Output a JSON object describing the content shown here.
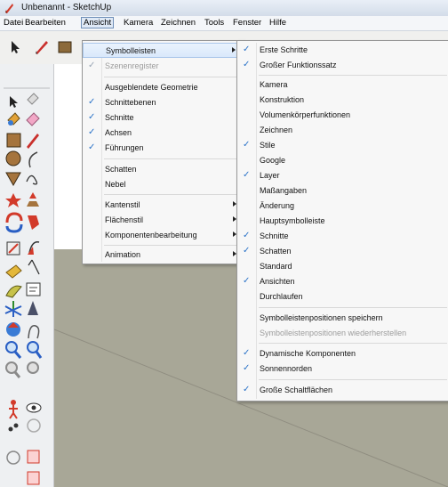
{
  "window": {
    "title": "Unbenannt - SketchUp"
  },
  "menubar": {
    "items": [
      "Datei",
      "Bearbeiten",
      "Ansicht",
      "Kamera",
      "Zeichnen",
      "Tools",
      "Fenster",
      "Hilfe"
    ],
    "active": "Ansicht"
  },
  "ansicht_menu": {
    "items": [
      {
        "label": "Symbolleisten",
        "checked": false,
        "submenu": true,
        "disabled": false
      },
      {
        "label": "Szenenregister",
        "checked": true,
        "submenu": false,
        "disabled": true
      },
      {
        "label": "Ausgeblendete Geometrie",
        "checked": false,
        "submenu": false,
        "disabled": false
      },
      {
        "label": "Schnittebenen",
        "checked": true,
        "submenu": false,
        "disabled": false
      },
      {
        "label": "Schnitte",
        "checked": true,
        "submenu": false,
        "disabled": false
      },
      {
        "label": "Achsen",
        "checked": true,
        "submenu": false,
        "disabled": false
      },
      {
        "label": "Führungen",
        "checked": true,
        "submenu": false,
        "disabled": false
      },
      {
        "label": "Schatten",
        "checked": false,
        "submenu": false,
        "disabled": false
      },
      {
        "label": "Nebel",
        "checked": false,
        "submenu": false,
        "disabled": false
      },
      {
        "label": "Kantenstil",
        "checked": false,
        "submenu": true,
        "disabled": false
      },
      {
        "label": "Flächenstil",
        "checked": false,
        "submenu": true,
        "disabled": false
      },
      {
        "label": "Komponentenbearbeitung",
        "checked": false,
        "submenu": true,
        "disabled": false
      },
      {
        "label": "Animation",
        "checked": false,
        "submenu": true,
        "disabled": false
      }
    ]
  },
  "symbolleisten_menu": {
    "items": [
      {
        "label": "Erste Schritte",
        "checked": true,
        "disabled": false
      },
      {
        "label": "Großer Funktionssatz",
        "checked": true,
        "disabled": false
      },
      {
        "label": "Kamera",
        "checked": false,
        "disabled": false
      },
      {
        "label": "Konstruktion",
        "checked": false,
        "disabled": false
      },
      {
        "label": "Volumenkörperfunktionen",
        "checked": false,
        "disabled": false
      },
      {
        "label": "Zeichnen",
        "checked": false,
        "disabled": false
      },
      {
        "label": "Stile",
        "checked": true,
        "disabled": false
      },
      {
        "label": "Google",
        "checked": false,
        "disabled": false
      },
      {
        "label": "Layer",
        "checked": true,
        "disabled": false
      },
      {
        "label": "Maßangaben",
        "checked": false,
        "disabled": false
      },
      {
        "label": "Änderung",
        "checked": false,
        "disabled": false
      },
      {
        "label": "Hauptsymbolleiste",
        "checked": false,
        "disabled": false
      },
      {
        "label": "Schnitte",
        "checked": true,
        "disabled": false
      },
      {
        "label": "Schatten",
        "checked": true,
        "disabled": false
      },
      {
        "label": "Standard",
        "checked": false,
        "disabled": false
      },
      {
        "label": "Ansichten",
        "checked": true,
        "disabled": false
      },
      {
        "label": "Durchlaufen",
        "checked": false,
        "disabled": false
      },
      {
        "label": "Symbolleistenpositionen speichern",
        "checked": false,
        "disabled": false
      },
      {
        "label": "Symbolleistenpositionen wiederherstellen",
        "checked": false,
        "disabled": true
      },
      {
        "label": "Dynamische Komponenten",
        "checked": true,
        "disabled": false
      },
      {
        "label": "Sonnennorden",
        "checked": true,
        "disabled": false
      },
      {
        "label": "Große Schaltflächen",
        "checked": true,
        "disabled": false
      }
    ]
  },
  "colors": {
    "accent": "#2b73c8",
    "ground": "#a8a797",
    "sky": "#ffffff"
  }
}
